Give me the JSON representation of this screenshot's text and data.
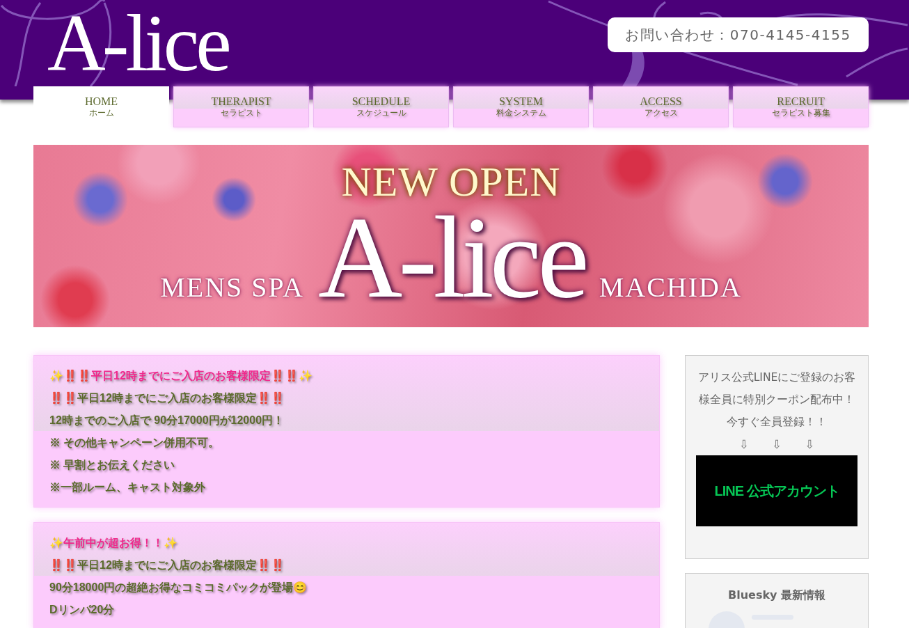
{
  "header": {
    "logo": "A-lice",
    "contact": "お問い合わせ：070-4145-4155"
  },
  "nav": [
    {
      "label": "HOME",
      "sublabel": "ホーム",
      "selected": true
    },
    {
      "label": "THERAPIST",
      "sublabel": "セラピスト",
      "selected": false
    },
    {
      "label": "SCHEDULE",
      "sublabel": "スケジュール",
      "selected": false
    },
    {
      "label": "SYSTEM",
      "sublabel": "料金システム",
      "selected": false
    },
    {
      "label": "ACCESS",
      "sublabel": "アクセス",
      "selected": false
    },
    {
      "label": "RECRUIT",
      "sublabel": "セラピスト募集",
      "selected": false
    }
  ],
  "banner": {
    "headline": "NEW OPEN",
    "left_text": "MENS SPA",
    "title": "A-lice",
    "right_text": "MACHIDA"
  },
  "notices": [
    {
      "lines": [
        {
          "kind": "headline",
          "text": "✨‼️‼️平日12時までにご入店のお客様限定‼️‼️✨"
        },
        {
          "kind": "body",
          "text": "‼️‼️平日12時までにご入店のお客様限定‼️‼️"
        },
        {
          "kind": "body",
          "text": "12時までのご入店で 90分17000円が12000円！"
        },
        {
          "kind": "body",
          "text": "※ その他キャンペーン併用不可。"
        },
        {
          "kind": "body",
          "text": "※ 早割とお伝えください"
        },
        {
          "kind": "body",
          "text": "※一部ルーム、キャスト対象外"
        }
      ]
    },
    {
      "lines": [
        {
          "kind": "headline",
          "text": "✨午前中が超お得！！✨"
        },
        {
          "kind": "body",
          "text": "‼️‼️平日12時までにご入店のお客様限定‼️‼️"
        },
        {
          "kind": "body",
          "text": "90分18000円の超絶お得なコミコミパックが登場😊"
        },
        {
          "kind": "body",
          "text": "Dリンパ20分"
        }
      ]
    }
  ],
  "sidebar": {
    "line_promo": {
      "text": "アリス公式LINEにご登録のお客様全員に特別クーポン配布中！",
      "cta": "今すぐ全員登録！！",
      "arrows": [
        "⇩",
        "⇩",
        "⇩"
      ],
      "button": "LINE 公式アカウント"
    },
    "bluesky": {
      "title": "Bluesky 最新情報"
    }
  }
}
